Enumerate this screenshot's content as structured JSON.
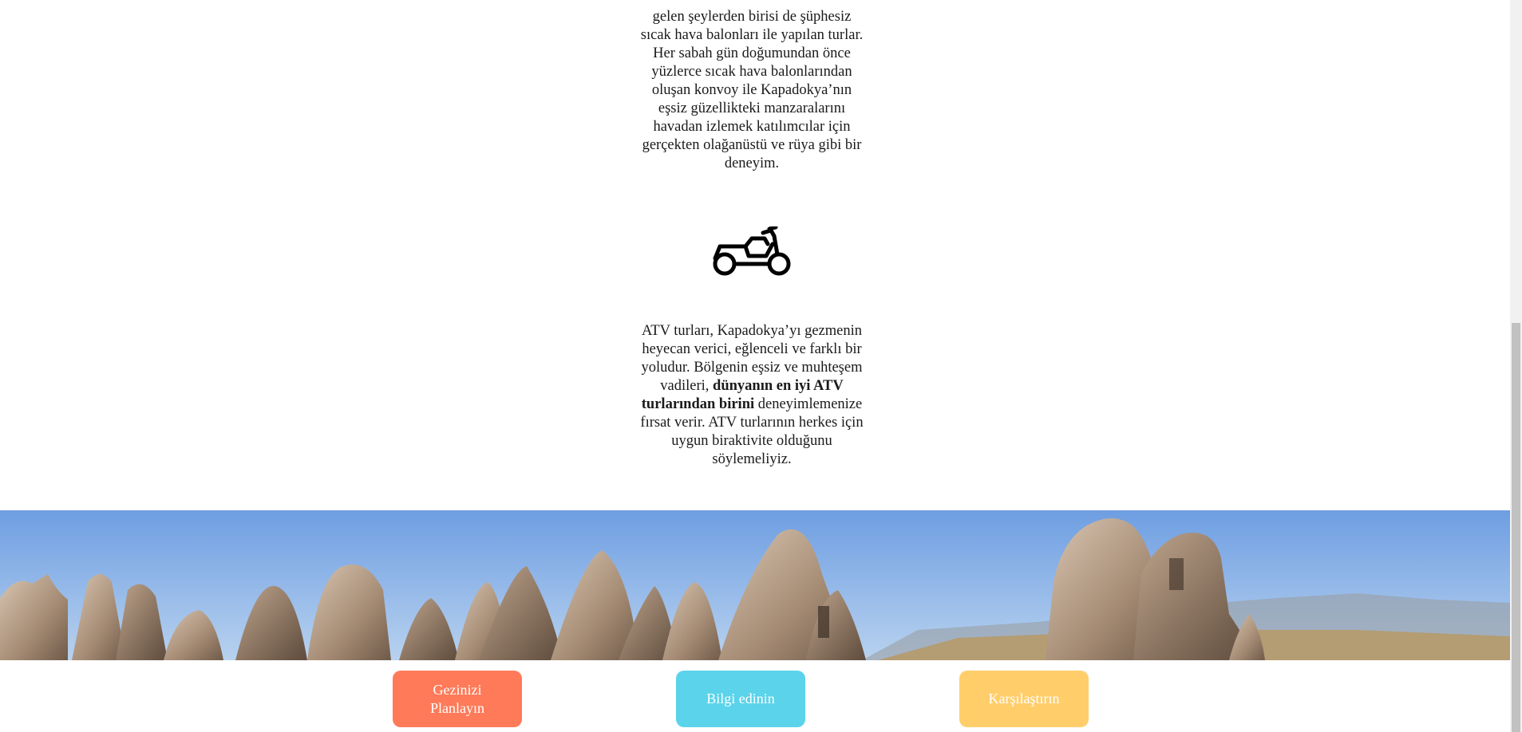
{
  "sections": {
    "balloon_text": "gelen şeylerden birisi de şüphesiz sıcak hava balonları ile yapılan turlar. Her sabah gün doğumundan önce yüzlerce sıcak hava balonlarından oluşan konvoy ile Kapadokya’nın eşsiz güzellikteki manzaralarını havadan izlemek katılımcılar için gerçekten olağanüstü ve rüya gibi bir deneyim.",
    "atv_text_before": "ATV turları, Kapadokya’yı gezmenin heyecan verici, eğlenceli ve farklı bir yoludur. Bölgenin eşsiz ve muhteşem vadileri, ",
    "atv_text_bold": "dünyanın en iyi ATV turlarından birini",
    "atv_text_after": " deneyimlemenize fırsat verir. ATV turlarının herkes için uygun biraktivite olduğunu söylemeliyiz."
  },
  "icons": {
    "atv": "atv-icon"
  },
  "cta": {
    "plan_label": "Gezinizi Planlayın",
    "info_label": "Bilgi edinin",
    "compare_label": "Karşılaştırın"
  },
  "colors": {
    "plan": "#ff7a59",
    "info": "#5bd3ea",
    "compare": "#ffce6b",
    "sky": "#7ba7e0"
  }
}
